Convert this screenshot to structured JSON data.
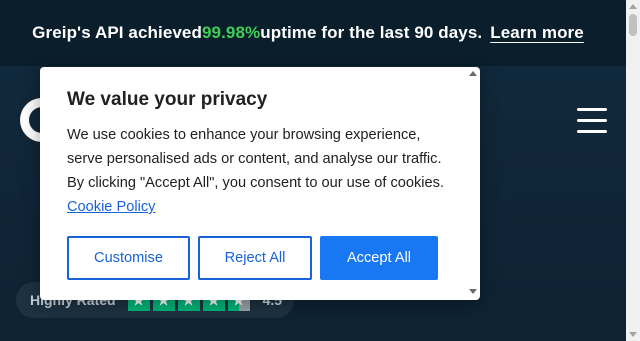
{
  "announcement": {
    "prefix": "Greip's API achieved ",
    "highlight": "99.98%",
    "suffix": " uptime for the last 90 days.",
    "link": "Learn more",
    "highlight_color": "#3ecf55"
  },
  "header": {
    "logo_icon": "greip-logo-icon",
    "menu_icon": "hamburger-menu-icon"
  },
  "rating": {
    "label": "Highly Rated",
    "stars": 4.5,
    "score": "4.5",
    "star_color": "#00b67a"
  },
  "cookie_modal": {
    "title": "We value your privacy",
    "body": "We use cookies to enhance your browsing experience, serve personalised ads or content, and analyse our traffic. By clicking \"Accept All\", you consent to our use of cookies.",
    "policy_link": "Cookie Policy",
    "buttons": {
      "customise": "Customise",
      "reject": "Reject All",
      "accept": "Accept All"
    },
    "accent_color": "#1863dc"
  }
}
